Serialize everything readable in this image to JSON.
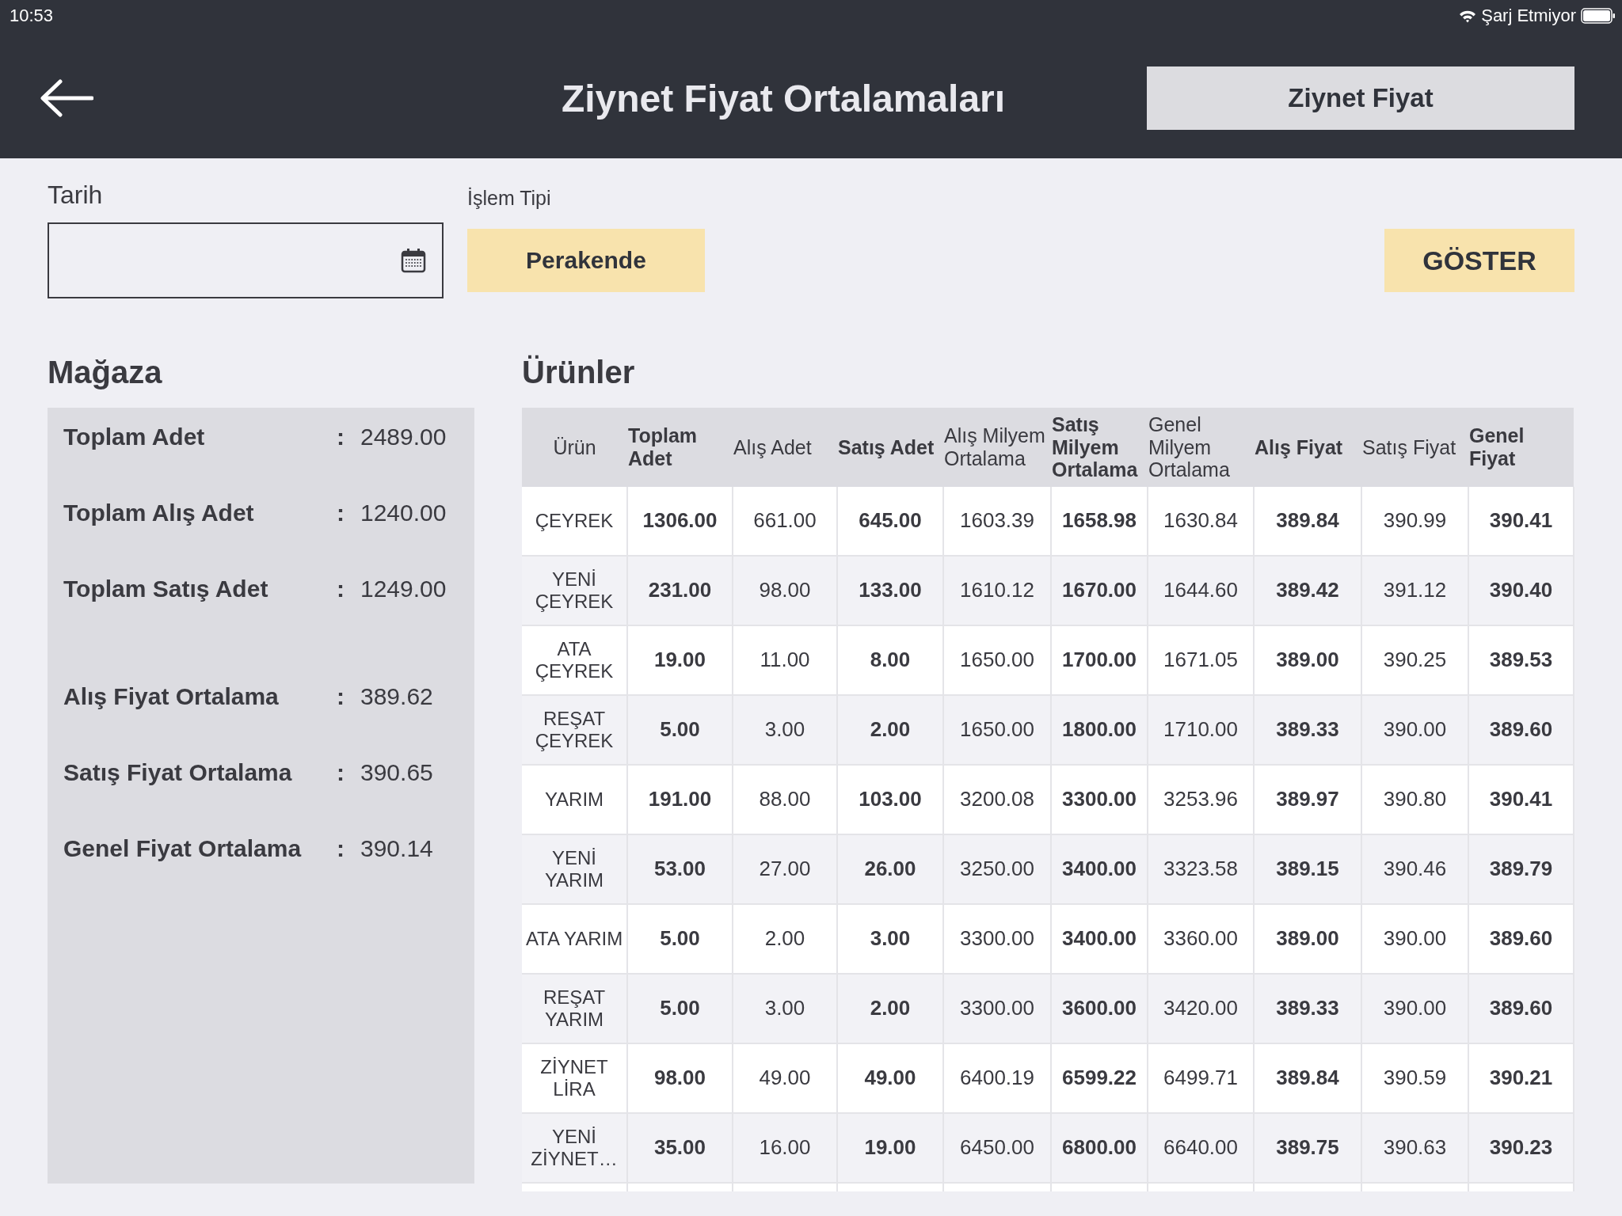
{
  "status_bar": {
    "time": "10:53",
    "battery_text": "Şarj Etmiyor"
  },
  "header": {
    "title": "Ziynet Fiyat Ortalamaları",
    "action_button": "Ziynet Fiyat"
  },
  "filters": {
    "date_label": "Tarih",
    "type_label": "İşlem Tipi",
    "type_button": "Perakende",
    "show_button": "GÖSTER"
  },
  "store": {
    "title": "Mağaza",
    "groups": [
      [
        {
          "label": "Toplam Adet",
          "separator": ":",
          "value": "2489.00"
        },
        {
          "label": "Toplam Alış Adet",
          "separator": ":",
          "value": "1240.00"
        },
        {
          "label": "Toplam Satış Adet",
          "separator": ":",
          "value": "1249.00"
        }
      ],
      [
        {
          "label": "Alış Fiyat Ortalama",
          "separator": ":",
          "value": "389.62"
        },
        {
          "label": "Satış Fiyat Ortalama",
          "separator": ":",
          "value": "390.65"
        },
        {
          "label": "Genel Fiyat Ortalama",
          "separator": ":",
          "value": "390.14"
        }
      ]
    ]
  },
  "products": {
    "title": "Ürünler",
    "columns": [
      {
        "label": "Ürün",
        "bold": false
      },
      {
        "label": "Toplam Adet",
        "bold": true
      },
      {
        "label": "Alış Adet",
        "bold": false
      },
      {
        "label": "Satış Adet",
        "bold": true
      },
      {
        "label": "Alış Milyem Ortalama",
        "bold": false
      },
      {
        "label": "Satış Milyem Ortalama",
        "bold": true
      },
      {
        "label": "Genel Milyem Ortalama",
        "bold": false
      },
      {
        "label": "Alış Fiyat",
        "bold": true
      },
      {
        "label": "Satış Fiyat",
        "bold": false
      },
      {
        "label": "Genel Fiyat",
        "bold": true
      }
    ],
    "rows": [
      [
        "ÇEYREK",
        "1306.00",
        "661.00",
        "645.00",
        "1603.39",
        "1658.98",
        "1630.84",
        "389.84",
        "390.99",
        "390.41"
      ],
      [
        "YENİ ÇEYREK",
        "231.00",
        "98.00",
        "133.00",
        "1610.12",
        "1670.00",
        "1644.60",
        "389.42",
        "391.12",
        "390.40"
      ],
      [
        "ATA ÇEYREK",
        "19.00",
        "11.00",
        "8.00",
        "1650.00",
        "1700.00",
        "1671.05",
        "389.00",
        "390.25",
        "389.53"
      ],
      [
        "REŞAT ÇEYREK",
        "5.00",
        "3.00",
        "2.00",
        "1650.00",
        "1800.00",
        "1710.00",
        "389.33",
        "390.00",
        "389.60"
      ],
      [
        "YARIM",
        "191.00",
        "88.00",
        "103.00",
        "3200.08",
        "3300.00",
        "3253.96",
        "389.97",
        "390.80",
        "390.41"
      ],
      [
        "YENİ YARIM",
        "53.00",
        "27.00",
        "26.00",
        "3250.00",
        "3400.00",
        "3323.58",
        "389.15",
        "390.46",
        "389.79"
      ],
      [
        "ATA YARIM",
        "5.00",
        "2.00",
        "3.00",
        "3300.00",
        "3400.00",
        "3360.00",
        "389.00",
        "390.00",
        "389.60"
      ],
      [
        "REŞAT YARIM",
        "5.00",
        "3.00",
        "2.00",
        "3300.00",
        "3600.00",
        "3420.00",
        "389.33",
        "390.00",
        "389.60"
      ],
      [
        "ZİYNET LİRA",
        "98.00",
        "49.00",
        "49.00",
        "6400.19",
        "6599.22",
        "6499.71",
        "389.84",
        "390.59",
        "390.21"
      ],
      [
        "YENİ ZİYNET…",
        "35.00",
        "16.00",
        "19.00",
        "6450.00",
        "6800.00",
        "6640.00",
        "389.75",
        "390.63",
        "390.23"
      ]
    ]
  }
}
